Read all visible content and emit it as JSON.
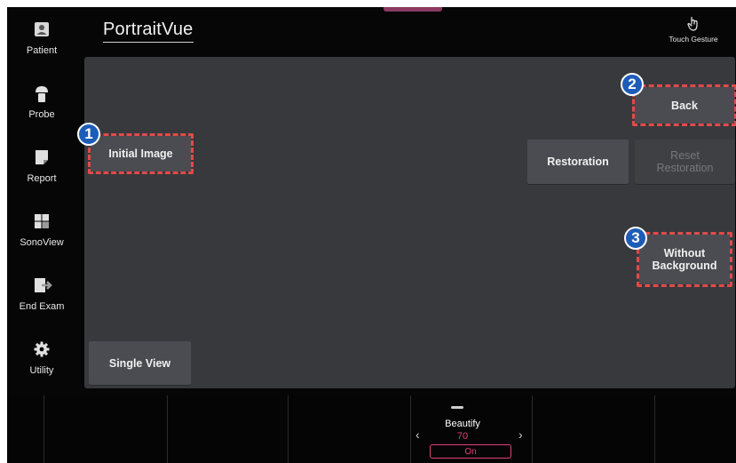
{
  "app": {
    "title": "PortraitVue",
    "touch_gesture_label": "Touch Gesture"
  },
  "sidebar": {
    "items": [
      {
        "label": "Patient",
        "icon": "patient-icon"
      },
      {
        "label": "Probe",
        "icon": "probe-icon"
      },
      {
        "label": "Report",
        "icon": "report-icon"
      },
      {
        "label": "SonoView",
        "icon": "sonoview-icon"
      },
      {
        "label": "End Exam",
        "icon": "end-exam-icon"
      },
      {
        "label": "Utility",
        "icon": "gear-icon"
      }
    ]
  },
  "panel": {
    "initial_image_label": "Initial Image",
    "back_label": "Back",
    "restoration_label": "Restoration",
    "reset_restoration_line1": "Reset",
    "reset_restoration_line2": "Restoration",
    "without_background_line1": "Without",
    "without_background_line2": "Background",
    "single_view_label": "Single View"
  },
  "annotations": {
    "badge1": "1",
    "badge2": "2",
    "badge3": "3"
  },
  "bottom_bar": {
    "beautify": {
      "label": "Beautify",
      "value": "70",
      "toggle_label": "On",
      "prev_icon": "chevron-left-icon",
      "next_icon": "chevron-right-icon"
    }
  },
  "colors": {
    "accent": "#e0407a",
    "callout_dash": "#e24a4a",
    "badge_blue": "#1d5db8",
    "panel_bg": "#38393d",
    "button_bg": "#4b4c51"
  }
}
